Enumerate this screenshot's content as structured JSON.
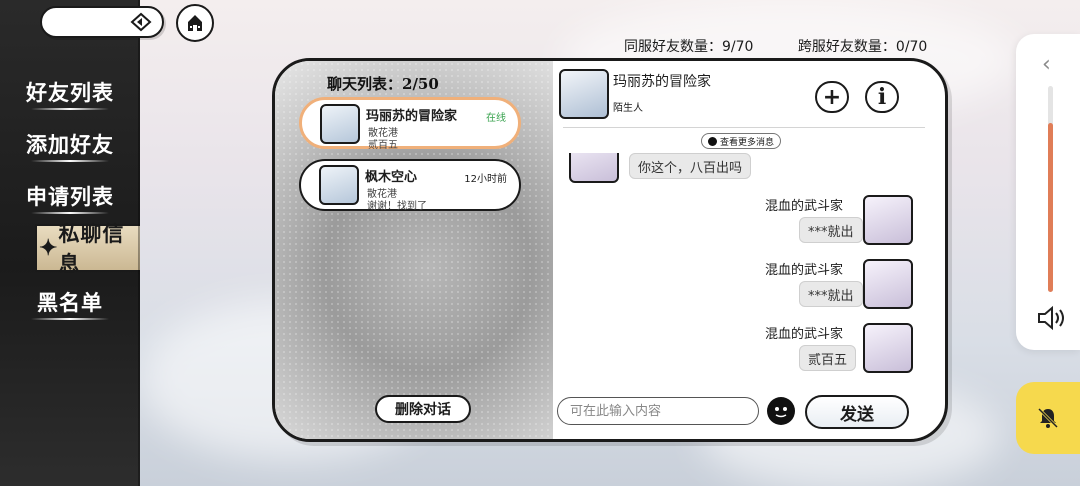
{
  "top": {
    "search_icon": "diamond-arrow-icon",
    "home_icon": "home-icon"
  },
  "counts": {
    "same_server": "同服好友数量：9/70",
    "cross_server": "跨服好友数量：0/70"
  },
  "sidebar": {
    "items": [
      {
        "label": "好友列表",
        "active": false
      },
      {
        "label": "添加好友",
        "active": false
      },
      {
        "label": "申请列表",
        "active": false
      },
      {
        "label": "私聊信息",
        "active": true
      },
      {
        "label": "黑名单",
        "active": false
      }
    ]
  },
  "chat_list": {
    "title": "聊天列表：2/50",
    "items": [
      {
        "name": "玛丽苏的冒险家",
        "server": "散花港",
        "last_message": "贰百五",
        "status": "在线",
        "selected": true
      },
      {
        "name": "枫木空心",
        "server": "散花港",
        "last_message": "谢谢！找到了",
        "status": "12小时前",
        "selected": false
      }
    ],
    "delete_label": "删除对话"
  },
  "conversation": {
    "peer_name": "玛丽苏的冒险家",
    "peer_relation": "陌生人",
    "add_icon": "plus-icon",
    "info_icon": "info-icon",
    "more_messages": "查看更多消息",
    "messages": [
      {
        "side": "left",
        "sender": "",
        "text": "你这个，八百出吗"
      },
      {
        "side": "right",
        "sender": "混血的武斗家",
        "text": "***就出"
      },
      {
        "side": "right",
        "sender": "混血的武斗家",
        "text": "***就出"
      },
      {
        "side": "right",
        "sender": "混血的武斗家",
        "text": "贰百五"
      }
    ],
    "input_placeholder": "可在此输入内容",
    "send_label": "发送"
  },
  "system_controls": {
    "volume_level": 0.82,
    "volume_color": "#e07d57",
    "chevron_icon": "chevron-left-icon",
    "speaker_icon": "speaker-icon",
    "bell_icon": "bell-off-icon",
    "bell_bg": "#f6d94d"
  }
}
